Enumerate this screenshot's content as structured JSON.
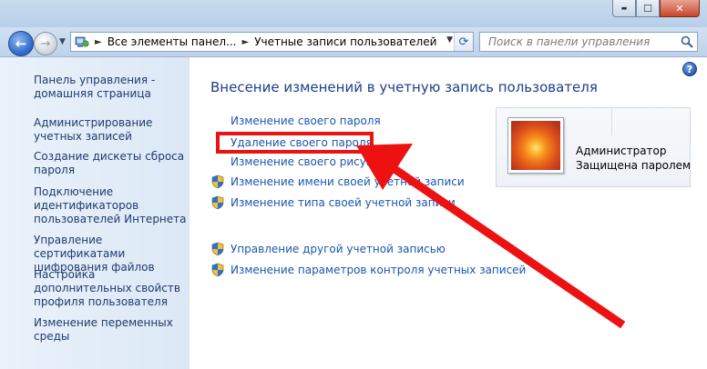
{
  "window": {
    "minimize_glyph": "▬",
    "maximize_glyph": "☐",
    "close_glyph": "✕"
  },
  "nav": {
    "back_glyph": "←",
    "forward_glyph": "→",
    "history_glyph": "▼"
  },
  "address": {
    "segments": [
      "Все элементы панел...",
      "Учетные записи пользователей"
    ],
    "separator": "►",
    "dropdown_glyph": "▼",
    "refresh_glyph": "⟳"
  },
  "search": {
    "placeholder": "Поиск в панели управления"
  },
  "sidebar": {
    "items": [
      {
        "label": "Панель управления - домашняя страница"
      },
      {
        "label": "Администрирование учетных записей"
      },
      {
        "label": "Создание дискеты сброса пароля"
      },
      {
        "label": "Подключение идентификаторов пользователей Интернета"
      },
      {
        "label": "Управление сертификатами шифрования файлов"
      },
      {
        "label": "Настройка дополнительных свойств профиля пользователя"
      },
      {
        "label": "Изменение переменных среды"
      }
    ]
  },
  "main": {
    "help_glyph": "?",
    "heading": "Внесение изменений в учетную запись пользователя",
    "tasks": [
      {
        "label": "Изменение своего пароля"
      },
      {
        "label": "Удаление своего пароля"
      },
      {
        "label": "Изменение своего рисунка"
      },
      {
        "label": "Изменение имени своей учетной записи"
      },
      {
        "label": "Изменение типа своей учетной записи"
      }
    ],
    "other_tasks": [
      {
        "label": "Управление другой учетной записью"
      },
      {
        "label": "Изменение параметров контроля учетных записей"
      }
    ]
  },
  "user": {
    "name": "Администратор",
    "status": "Защищена паролем"
  },
  "colors": {
    "link": "#1b56b0",
    "heading": "#1e3f8a",
    "annotation": "#ee1111"
  }
}
